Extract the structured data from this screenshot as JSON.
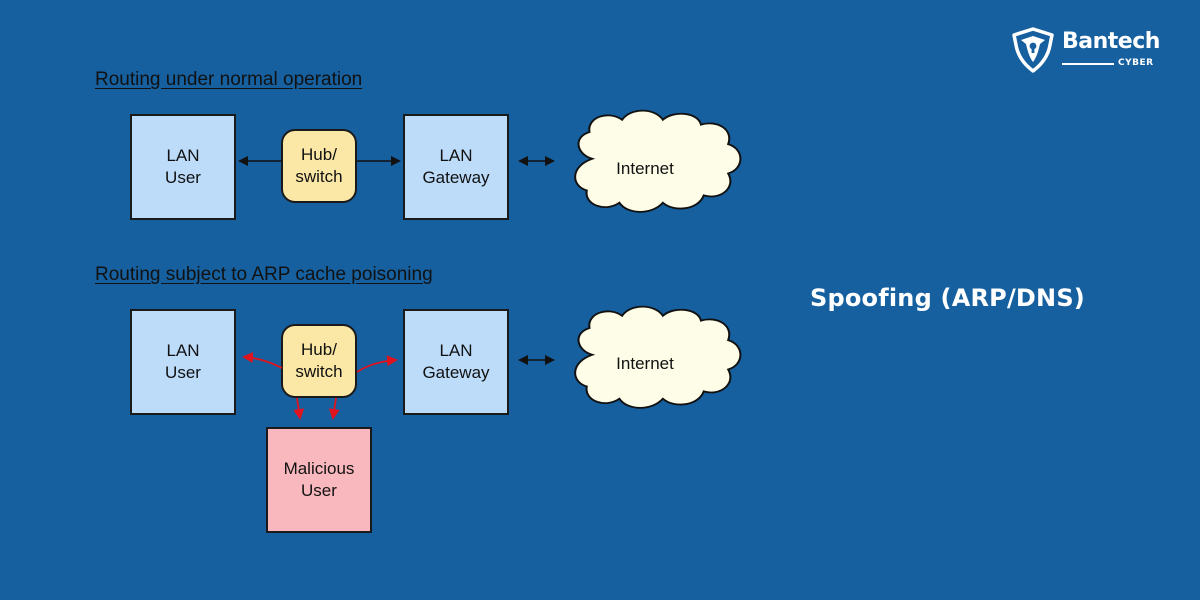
{
  "brand": {
    "name": "Bantech",
    "sub": "CYBER",
    "icon": "shield-lock-icon"
  },
  "headline": "Spoofing (ARP/DNS)",
  "colors": {
    "background": "#1660a0",
    "lan_box": "#bcdcfa",
    "hub_box": "#fbe7a6",
    "malicious_box": "#f8b8bd",
    "cloud": "#fdfde8",
    "normal_arrow": "#111111",
    "poison_arrow": "#e0141e"
  },
  "diagrams": {
    "normal": {
      "title": "Routing under normal operation",
      "lan_user": [
        "LAN",
        "User"
      ],
      "hub": [
        "Hub/",
        "switch"
      ],
      "gateway": [
        "LAN",
        "Gateway"
      ],
      "internet": "Internet"
    },
    "poisoned": {
      "title": "Routing subject to ARP cache poisoning",
      "lan_user": [
        "LAN",
        "User"
      ],
      "hub": [
        "Hub/",
        "switch"
      ],
      "gateway": [
        "LAN",
        "Gateway"
      ],
      "internet": "Internet",
      "malicious": [
        "Malicious",
        "User"
      ]
    }
  }
}
